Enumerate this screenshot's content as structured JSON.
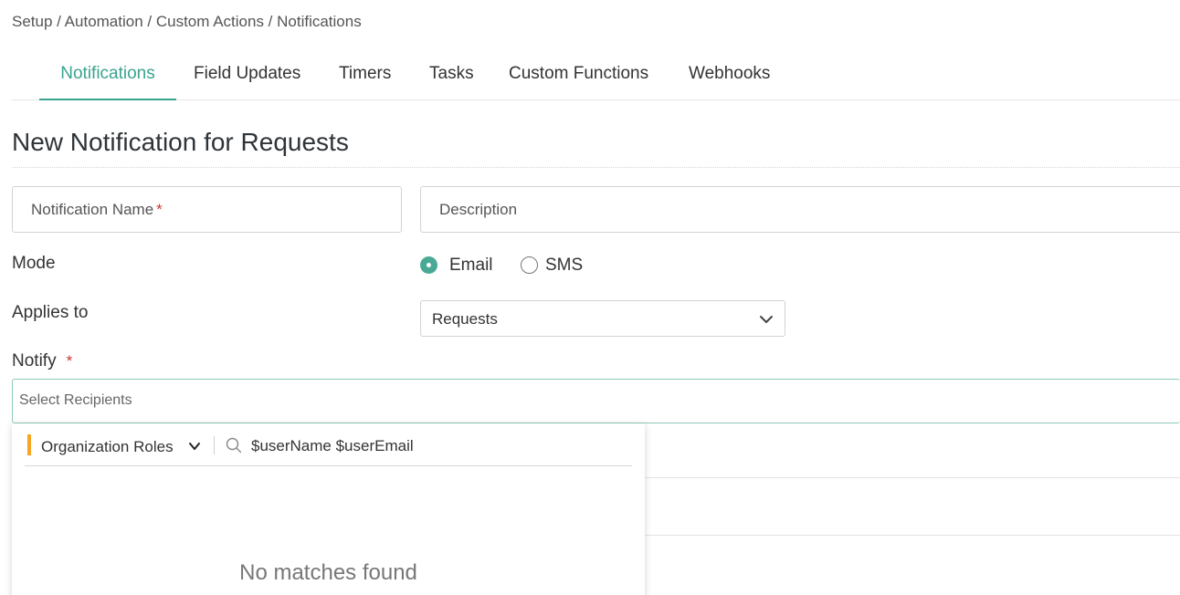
{
  "breadcrumb": {
    "items": [
      "Setup",
      "Automation",
      "Custom Actions",
      "Notifications"
    ],
    "separator": " / "
  },
  "tabs": [
    {
      "label": "Notifications",
      "active": true
    },
    {
      "label": "Field Updates",
      "active": false
    },
    {
      "label": "Timers",
      "active": false
    },
    {
      "label": "Tasks",
      "active": false
    },
    {
      "label": "Custom Functions",
      "active": false
    },
    {
      "label": "Webhooks",
      "active": false
    }
  ],
  "page": {
    "title": "New Notification for Requests"
  },
  "form": {
    "name_label": "Notification Name",
    "required_mark": "*",
    "description_label": "Description",
    "mode_label": "Mode",
    "mode_options": [
      {
        "label": "Email",
        "selected": true
      },
      {
        "label": "SMS",
        "selected": false
      }
    ],
    "applies_to_label": "Applies to",
    "applies_to_value": "Requests",
    "notify_label": "Notify",
    "recipients_placeholder": "Select Recipients"
  },
  "recipient_dropdown": {
    "filter_label": "Organization Roles",
    "search_value": "$userName $userEmail",
    "empty_message": "No matches found",
    "filter_accent_color": "#f5a623"
  },
  "colors": {
    "accent": "#3aa38f",
    "required": "#d0342c"
  },
  "icons": {
    "select_chevron": "chevron-down-icon",
    "filter_chevron": "chevron-down-icon",
    "search": "search-icon"
  }
}
